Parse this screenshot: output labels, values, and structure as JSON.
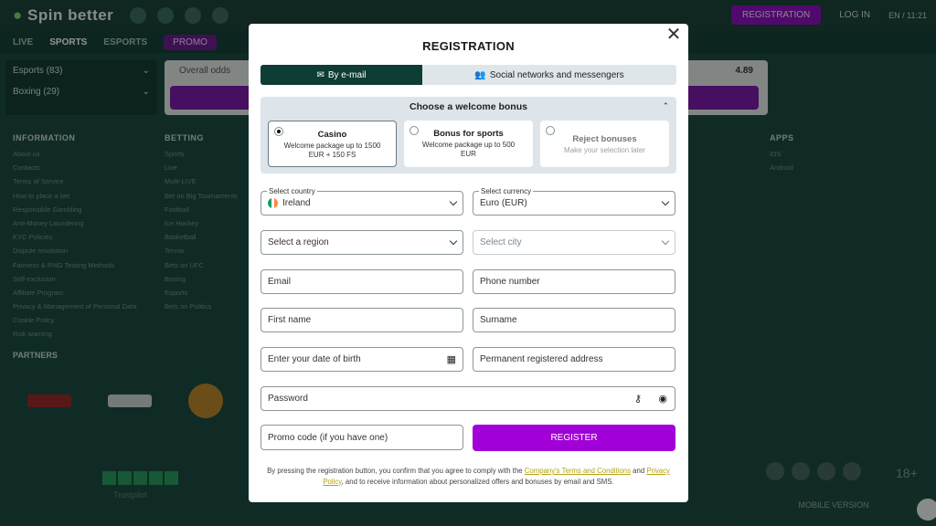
{
  "background": {
    "logo": "Spin better",
    "registration_btn": "REGISTRATION",
    "login_btn": "LOG IN",
    "lang": "EN / 11:21",
    "nav": [
      "LIVE",
      "SPORTS",
      "ESPORTS"
    ],
    "promo": "PROMO",
    "sidebar": [
      "Esports (83)",
      "Boxing (29)"
    ],
    "overall_odds": "Overall odds",
    "odds_value": "4.89",
    "footer": {
      "information_title": "INFORMATION",
      "information": [
        "About us",
        "Contacts",
        "Terms of Service",
        "How to place a bet",
        "Responsible Gambling",
        "Anti-Money Laundering",
        "KYC Policies",
        "Dispute resolution",
        "Fairness & RNG Testing Methods",
        "Self-exclusion",
        "Affiliate Program",
        "Privacy & Management of Personal Data",
        "Cookie Policy",
        "Risk warning"
      ],
      "betting_title": "BETTING",
      "betting": [
        "Sports",
        "Live",
        "Multi-LIVE",
        "Bet on Big Tournaments",
        "Football",
        "Ice Hockey",
        "Basketball",
        "Tennis",
        "Bets on UFC",
        "Boxing",
        "Esports",
        "Bets on Politics"
      ],
      "apps_title": "APPS",
      "apps": [
        "iOS",
        "Android"
      ]
    },
    "partners": "PARTNERS",
    "trustpilot": "Trustpilot",
    "age": "18+",
    "mobile_version": "MOBILE VERSION"
  },
  "modal": {
    "title": "REGISTRATION",
    "tabs": [
      {
        "label": "By e-mail",
        "icon": "envelope-icon"
      },
      {
        "label": "Social networks and messengers",
        "icon": "people-icon"
      }
    ],
    "bonus": {
      "heading": "Choose a welcome bonus",
      "options": [
        {
          "title": "Casino",
          "desc": "Welcome package up to 1500 EUR + 150 FS"
        },
        {
          "title": "Bonus for sports",
          "desc": "Welcome package up to 500 EUR"
        },
        {
          "title": "Reject bonuses",
          "desc": "Make your selection later"
        }
      ]
    },
    "country_label": "Select country",
    "country_value": "Ireland",
    "currency_label": "Select currency",
    "currency_value": "Euro (EUR)",
    "region": "Select a region",
    "city": "Select city",
    "email": "Email",
    "phone": "Phone number",
    "first_name": "First name",
    "surname": "Surname",
    "dob": "Enter your date of birth",
    "address": "Permanent registered address",
    "password": "Password",
    "promo": "Promo code (if you have one)",
    "register": "REGISTER",
    "legal_1": "By pressing the registration button, you confirm that you agree to comply with the ",
    "legal_link_1": "Company's Terms and Conditions",
    "legal_2": " and ",
    "legal_link_2": "Privacy Policy",
    "legal_3": ", and to receive information about personalized offers and bonuses by email and SMS."
  }
}
